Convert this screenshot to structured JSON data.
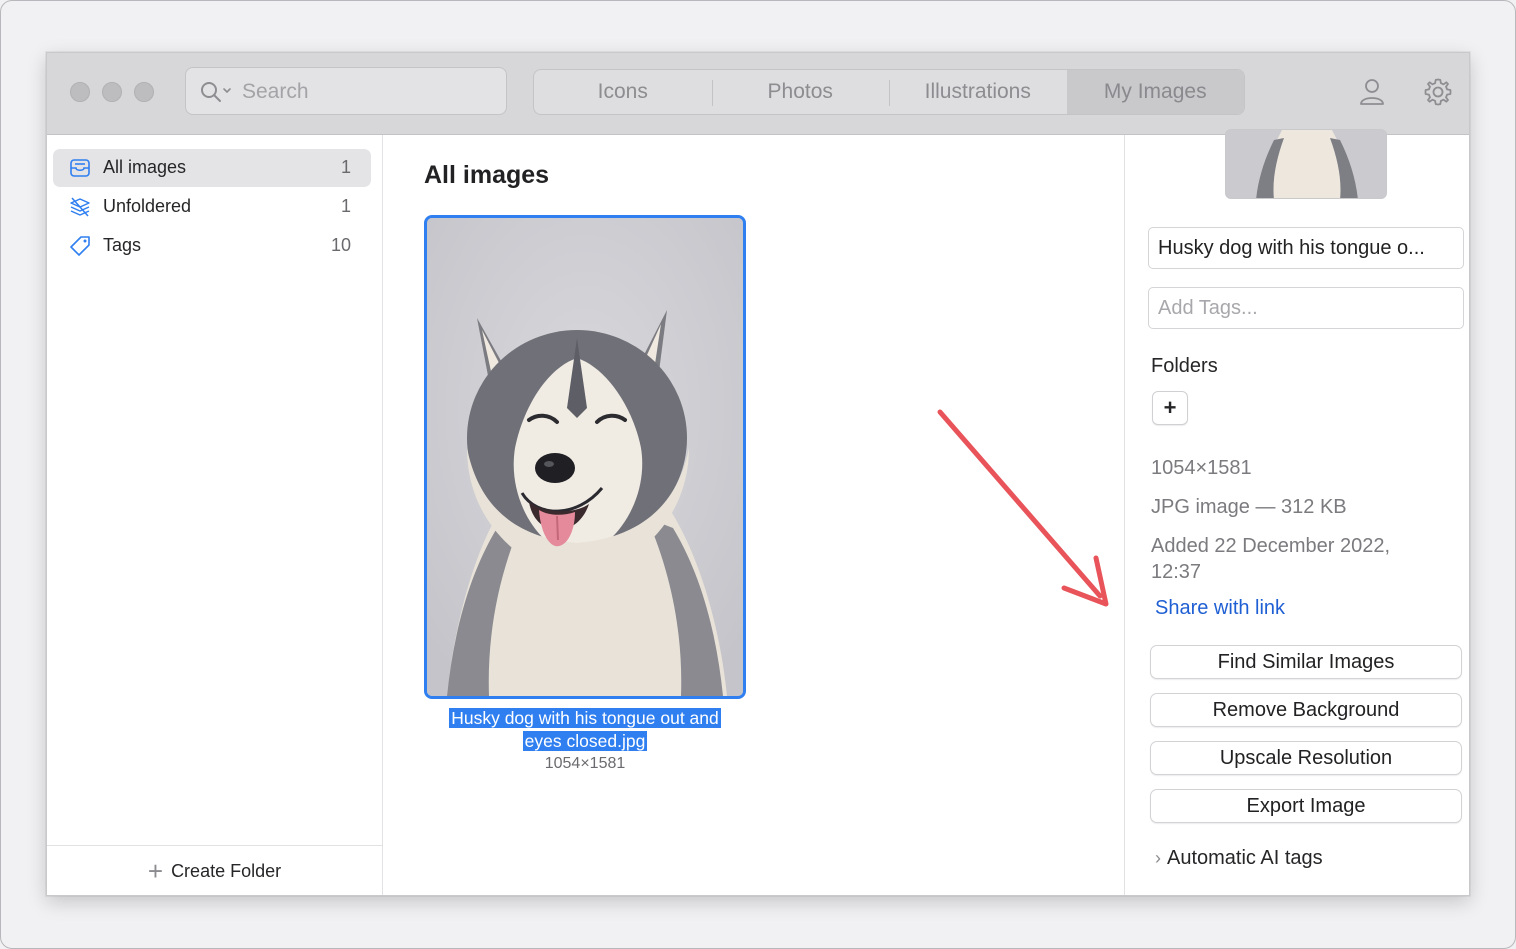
{
  "toolbar": {
    "search_placeholder": "Search",
    "tabs": [
      {
        "label": "Icons",
        "active": false
      },
      {
        "label": "Photos",
        "active": false
      },
      {
        "label": "Illustrations",
        "active": false
      },
      {
        "label": "My Images",
        "active": true
      }
    ],
    "icons": [
      "search-icon",
      "account-icon",
      "gear-icon"
    ]
  },
  "sidebar": {
    "items": [
      {
        "label": "All images",
        "count": "1",
        "icon": "tray-icon",
        "selected": true
      },
      {
        "label": "Unfoldered",
        "count": "1",
        "icon": "stack-icon",
        "selected": false
      },
      {
        "label": "Tags",
        "count": "10",
        "icon": "tag-icon",
        "selected": false
      }
    ],
    "footer_label": "Create Folder"
  },
  "main": {
    "title": "All images",
    "image": {
      "filename_line1": "Husky dog with his tongue out and",
      "filename_line2": "eyes closed.jpg",
      "dimensions": "1054×1581"
    }
  },
  "inspector": {
    "name_value": "Husky dog with his tongue o...",
    "tags_placeholder": "Add Tags...",
    "folders_label": "Folders",
    "add_folder_symbol": "+",
    "dimensions": "1054×1581",
    "file_info": "JPG image — 312 KB",
    "added_line1": "Added 22 December 2022,",
    "added_line2": "12:37",
    "share_link": "Share with link",
    "actions": [
      "Find Similar Images",
      "Remove Background",
      "Upscale Resolution",
      "Export Image"
    ],
    "ai_tags_label": "Automatic AI tags"
  },
  "colors": {
    "accent": "#2f7ff0",
    "link": "#1f5fd4",
    "annotation_arrow": "#e8545a"
  }
}
